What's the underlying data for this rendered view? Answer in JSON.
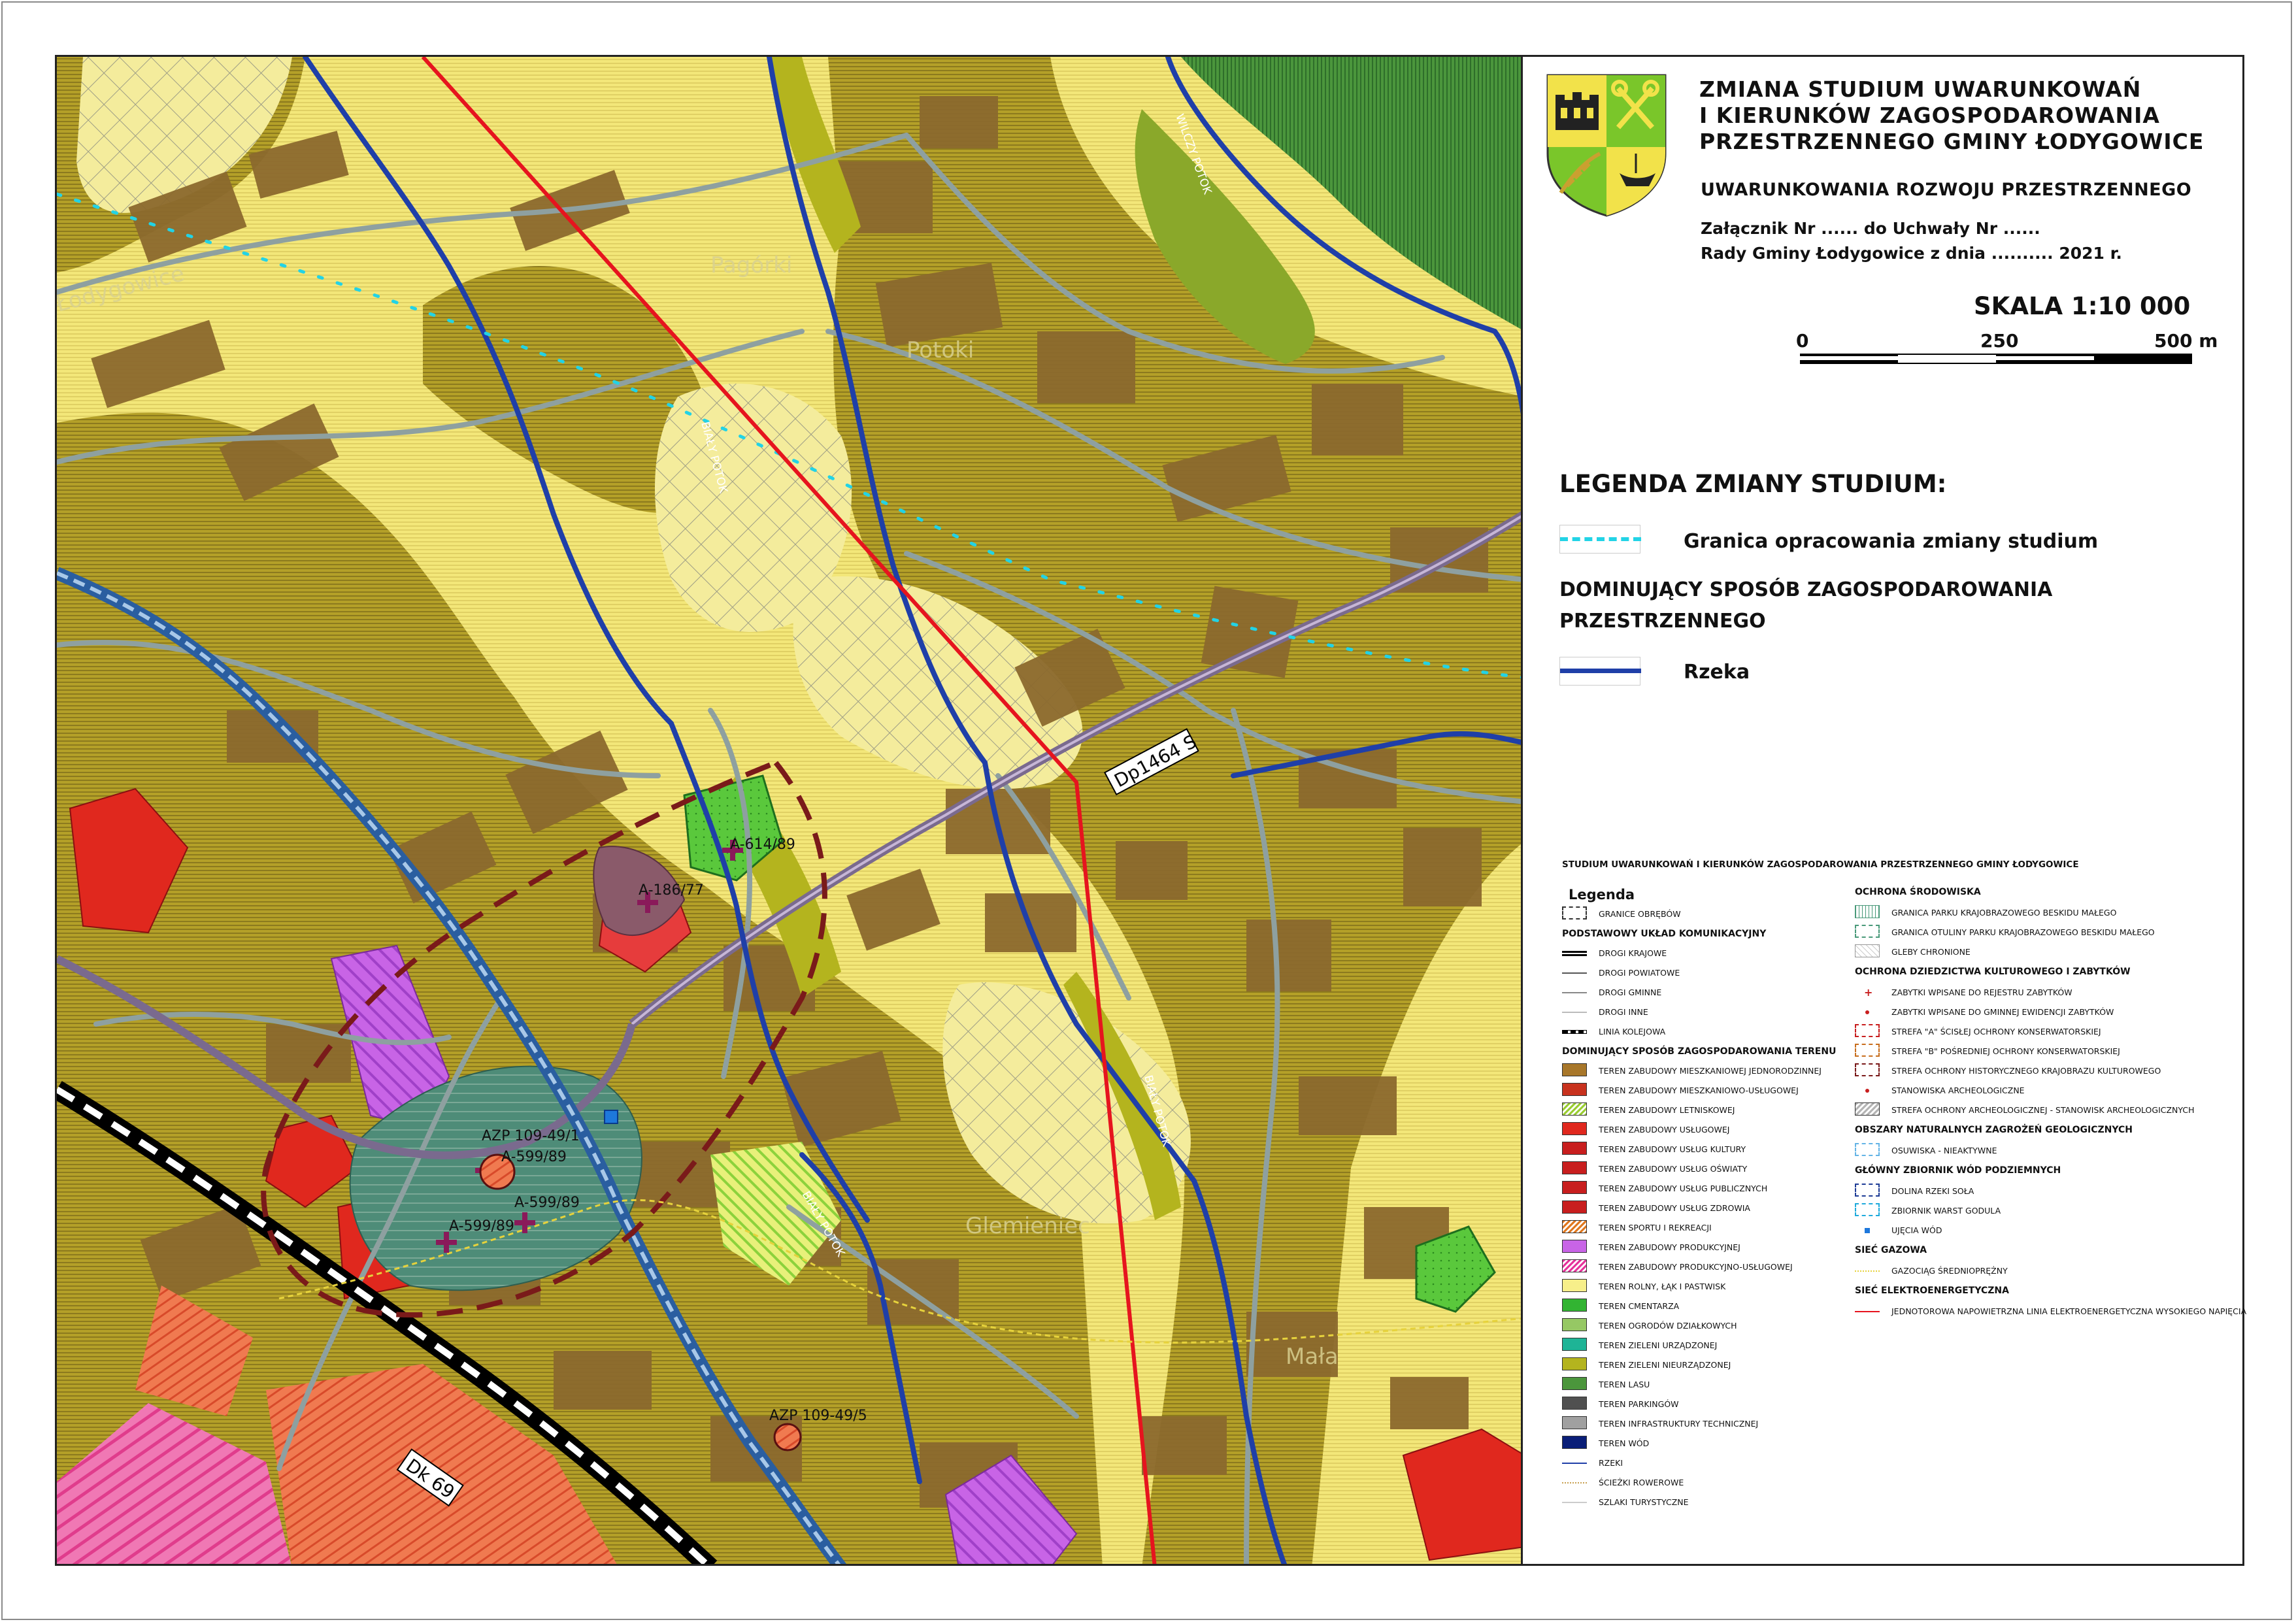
{
  "header": {
    "title_lines": [
      "ZMIANA STUDIUM UWARUNKOWAŃ",
      "I KIERUNKÓW ZAGOSPODAROWANIA",
      "PRZESTRZENNEGO GMINY ŁODYGOWICE"
    ],
    "subtitle": "UWARUNKOWANIA ROZWOJU PRZESTRZENNEGO",
    "annex_line1": "Załącznik Nr ...... do Uchwały Nr ......",
    "annex_line2": "Rady Gminy Łodygowice z dnia .......... 2021 r."
  },
  "scale": {
    "label": "SKALA 1:10 000",
    "tick0": "0",
    "tick1": "250",
    "tick2": "500 m"
  },
  "change_legend": {
    "title": "LEGENDA ZMIANY STUDIUM:",
    "boundary_label": "Granica opracowania zmiany studium",
    "dominant_heading_line1": "DOMINUJĄCY SPOSÓB ZAGOSPODAROWANIA",
    "dominant_heading_line2": "PRZESTRZENNEGO",
    "river_label": "Rzeka",
    "boundary_color": "#22d3e6",
    "river_color": "#1f3fa8"
  },
  "main_legend": {
    "title": "STUDIUM UWARUNKOWAŃ I KIERUNKÓW ZAGOSPODAROWANIA PRZESTRZENNEGO GMINY ŁODYGOWICE",
    "legenda": "Legenda",
    "left": [
      {
        "kind": "item",
        "label": "GRANICE OBRĘBÓW",
        "color": "none",
        "icon": "dashed-box"
      },
      {
        "kind": "heading",
        "label": "PODSTAWOWY UKŁAD KOMUNIKACYJNY"
      },
      {
        "kind": "item",
        "label": "DROGI KRAJOWE",
        "color": "#000000",
        "icon": "double-line"
      },
      {
        "kind": "item",
        "label": "DROGI POWIATOWE",
        "color": "#555555",
        "icon": "line"
      },
      {
        "kind": "item",
        "label": "DROGI GMINNE",
        "color": "#888888",
        "icon": "line"
      },
      {
        "kind": "item",
        "label": "DROGI INNE",
        "color": "#bbbbbb",
        "icon": "line"
      },
      {
        "kind": "item",
        "label": "LINIA KOLEJOWA",
        "color": "#000000",
        "icon": "rail"
      },
      {
        "kind": "heading",
        "label": "DOMINUJĄCY SPOSÓB ZAGOSPODAROWANIA TERENU"
      },
      {
        "kind": "item",
        "label": "TEREN ZABUDOWY MIESZKANIOWEJ JEDNORODZINNEJ",
        "color": "#a8772a",
        "icon": "fill"
      },
      {
        "kind": "item",
        "label": "TEREN ZABUDOWY MIESZKANIOWO-USŁUGOWEJ",
        "color": "#c8321e",
        "icon": "fill"
      },
      {
        "kind": "item",
        "label": "TEREN ZABUDOWY LETNISKOWEJ",
        "color": "#9acd32",
        "icon": "hatch"
      },
      {
        "kind": "item",
        "label": "TEREN ZABUDOWY USŁUGOWEJ",
        "color": "#e0281e",
        "icon": "fill"
      },
      {
        "kind": "item",
        "label": "TEREN ZABUDOWY USŁUG KULTURY",
        "color": "#c81e1e",
        "icon": "fill"
      },
      {
        "kind": "item",
        "label": "TEREN ZABUDOWY USŁUG OŚWIATY",
        "color": "#c81e1e",
        "icon": "fill"
      },
      {
        "kind": "item",
        "label": "TEREN ZABUDOWY USŁUG PUBLICZNYCH",
        "color": "#c81e1e",
        "icon": "fill"
      },
      {
        "kind": "item",
        "label": "TEREN ZABUDOWY USŁUG ZDROWIA",
        "color": "#c81e1e",
        "icon": "fill"
      },
      {
        "kind": "item",
        "label": "TEREN SPORTU I REKREACJI",
        "color": "#e0781e",
        "icon": "hatch"
      },
      {
        "kind": "item",
        "label": "TEREN ZABUDOWY PRODUKCYJNEJ",
        "color": "#c864e6",
        "icon": "fill"
      },
      {
        "kind": "item",
        "label": "TEREN ZABUDOWY PRODUKCYJNO-USŁUGOWEJ",
        "color": "#e6329b",
        "icon": "hatch"
      },
      {
        "kind": "item",
        "label": "TEREN ROLNY, ŁĄK I PASTWISK",
        "color": "#f7ef8a",
        "icon": "fill"
      },
      {
        "kind": "item",
        "label": "TEREN CMENTARZA",
        "color": "#32b432",
        "icon": "fill"
      },
      {
        "kind": "item",
        "label": "TEREN OGRODÓW DZIAŁKOWYCH",
        "color": "#96c864",
        "icon": "fill"
      },
      {
        "kind": "item",
        "label": "TEREN ZIELENI URZĄDZONEJ",
        "color": "#1eb496",
        "icon": "fill"
      },
      {
        "kind": "item",
        "label": "TEREN ZIELENI NIEURZĄDZONEJ",
        "color": "#b4b41e",
        "icon": "fill"
      },
      {
        "kind": "item",
        "label": "TEREN LASU",
        "color": "#4b963c",
        "icon": "fill"
      },
      {
        "kind": "item",
        "label": "TEREN PARKINGÓW",
        "color": "#505050",
        "icon": "fill"
      },
      {
        "kind": "item",
        "label": "TEREN INFRASTRUKTURY TECHNICZNEJ",
        "color": "#a0a0a0",
        "icon": "fill"
      },
      {
        "kind": "item",
        "label": "TEREN WÓD",
        "color": "#0a1e78",
        "icon": "fill"
      },
      {
        "kind": "item",
        "label": "RZEKI",
        "color": "#1f3fa8",
        "icon": "line"
      },
      {
        "kind": "item",
        "label": "ŚCIEŻKI ROWEROWE",
        "color": "#c8a050",
        "icon": "dotline"
      },
      {
        "kind": "item",
        "label": "SZLAKI TURYSTYCZNE",
        "color": "#cccccc",
        "icon": "line"
      }
    ],
    "right": [
      {
        "kind": "heading",
        "label": "OCHRONA ŚRODOWISKA"
      },
      {
        "kind": "item",
        "label": "GRANICA PARKU KRAJOBRAZOWEGO BESKIDU MAŁEGO",
        "color": "#4a9a7a",
        "icon": "vhatch"
      },
      {
        "kind": "item",
        "label": "GRANICA OTULINY PARKU KRAJOBRAZOWEGO BESKIDU MAŁEGO",
        "color": "#4a9a7a",
        "icon": "dashed-box"
      },
      {
        "kind": "item",
        "label": "GLEBY CHRONIONE",
        "color": "#9a9a9a",
        "icon": "cross"
      },
      {
        "kind": "heading",
        "label": "OCHRONA DZIEDZICTWA KULTUROWEGO I ZABYTKÓW"
      },
      {
        "kind": "item",
        "label": "ZABYTKI WPISANE DO REJESTRU ZABYTKÓW",
        "color": "#c81e1e",
        "icon": "plus"
      },
      {
        "kind": "item",
        "label": "ZABYTKI WPISANE DO GMINNEJ EWIDENCJI ZABYTKÓW",
        "color": "#c81e1e",
        "icon": "dot"
      },
      {
        "kind": "item",
        "label": "STREFA \"A\" ŚCISŁEJ OCHRONY KONSERWATORSKIEJ",
        "color": "#c81e1e",
        "icon": "dashed-box"
      },
      {
        "kind": "item",
        "label": "STREFA \"B\" POŚREDNIEJ OCHRONY KONSERWATORSKIEJ",
        "color": "#c86e1e",
        "icon": "dashed-box"
      },
      {
        "kind": "item",
        "label": "STREFA OCHRONY HISTORYCZNEGO KRAJOBRAZU KULTUROWEGO",
        "color": "#7a1a1a",
        "icon": "dashed-box"
      },
      {
        "kind": "item",
        "label": "STANOWISKA ARCHEOLOGICZNE",
        "color": "#c81e1e",
        "icon": "dot"
      },
      {
        "kind": "item",
        "label": "STREFA OCHRONY ARCHEOLOGICZNEJ - STANOWISK ARCHEOLOGICZNYCH",
        "color": "#b4b4b4",
        "icon": "hatch"
      },
      {
        "kind": "heading",
        "label": "OBSZARY NATURALNYCH ZAGROŻEŃ GEOLOGICZNYCH"
      },
      {
        "kind": "item",
        "label": "OSUWISKA - NIEAKTYWNE",
        "color": "#64b4e6",
        "icon": "dashed-box"
      },
      {
        "kind": "heading",
        "label": "GŁÓWNY ZBIORNIK WÓD PODZIEMNYCH"
      },
      {
        "kind": "item",
        "label": "DOLINA RZEKI SOŁA",
        "color": "#1e3c96",
        "icon": "dashed-box"
      },
      {
        "kind": "item",
        "label": "ZBIORNIK WARST GODULA",
        "color": "#1eaadc",
        "icon": "dashed-box"
      },
      {
        "kind": "item",
        "label": "UJĘCIA WÓD",
        "color": "#1e78dc",
        "icon": "square"
      },
      {
        "kind": "heading",
        "label": "SIEĆ GAZOWA"
      },
      {
        "kind": "item",
        "label": "GAZOCIĄG ŚREDNIOPRĘŻNY",
        "color": "#e6d23c",
        "icon": "dotline"
      },
      {
        "kind": "heading",
        "label": "SIEĆ ELEKTROENERGETYCZNA"
      },
      {
        "kind": "item",
        "label": "JEDNOTOROWA NAPOWIETRZNA LINIA ELEKTROENERGETYCZNA WYSOKIEGO NAPIĘCIA",
        "color": "#e6141e",
        "icon": "line"
      }
    ]
  },
  "map": {
    "road_labels": [
      "Dp1464 S",
      "Dk 69"
    ],
    "stream_labels": [
      "WILCZY POTOK",
      "BIAŁY POTOK",
      "BIAŁY POTOK",
      "BIAŁY POTOK",
      "BIAŁY POTOK"
    ],
    "place_labels": [
      "Łodygowice",
      "Potoki",
      "Glemieniec",
      "Mała",
      "Pagórki"
    ],
    "site_labels": [
      "A-614/89",
      "A-186/77",
      "AZP 109-49/1",
      "A-599/89",
      "A-599/89",
      "A-599/89",
      "AZP 109-49/5"
    ],
    "colors": {
      "agri": "#f7ef8a",
      "residential": "#a8772a",
      "greenery": "#b4b41e",
      "forest": "#4b963c",
      "services": "#e0281e",
      "production": "#c864e6",
      "river": "#1f3fa8",
      "power_line": "#e6141e",
      "boundary": "#22d3e6"
    }
  }
}
